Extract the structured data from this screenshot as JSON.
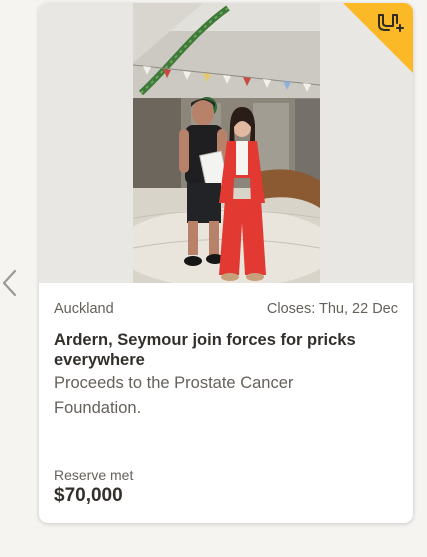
{
  "carousel": {
    "prev_icon": "chevron-left-icon"
  },
  "listing": {
    "badge_icon": "watchlist-add-icon",
    "badge_color": "#fbb928",
    "location": "Auckland",
    "closes": "Closes: Thu, 22 Dec",
    "title": "Ardern, Seymour join forces for pricks everywhere",
    "subtitle": "Proceeds to the Prostate Cancer Foundation.",
    "reserve_status": "Reserve met",
    "price": "$70,000"
  }
}
